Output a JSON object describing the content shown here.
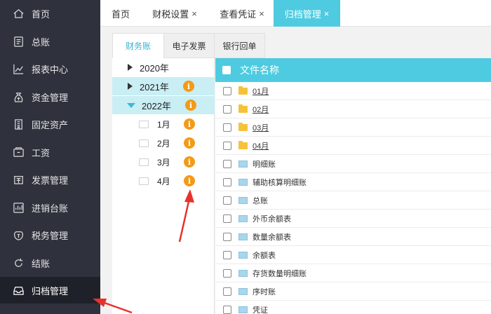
{
  "sidebar": {
    "items": [
      {
        "label": "首页",
        "icon": "home-icon"
      },
      {
        "label": "总账",
        "icon": "ledger-icon"
      },
      {
        "label": "报表中心",
        "icon": "chart-icon"
      },
      {
        "label": "资金管理",
        "icon": "money-bag-icon"
      },
      {
        "label": "固定资产",
        "icon": "building-icon"
      },
      {
        "label": "工资",
        "icon": "wallet-icon"
      },
      {
        "label": "发票管理",
        "icon": "invoice-icon"
      },
      {
        "label": "进销台账",
        "icon": "inventory-icon"
      },
      {
        "label": "税务管理",
        "icon": "tax-icon"
      },
      {
        "label": "结账",
        "icon": "refresh-icon"
      },
      {
        "label": "归档管理",
        "icon": "archive-icon"
      }
    ],
    "active_index": 10
  },
  "top_tabs": [
    {
      "label": "首页",
      "closable": false
    },
    {
      "label": "财税设置",
      "closable": true
    },
    {
      "label": "查看凭证",
      "closable": true
    },
    {
      "label": "归档管理",
      "closable": true,
      "active": true
    }
  ],
  "close_glyph": "×",
  "sub_tabs": [
    {
      "label": "财务账",
      "active": true
    },
    {
      "label": "电子发票"
    },
    {
      "label": "银行回单"
    }
  ],
  "tree": {
    "years": [
      {
        "label": "2020年",
        "badge": false
      },
      {
        "label": "2021年",
        "badge": true
      },
      {
        "label": "2022年",
        "badge": true,
        "expanded": true
      }
    ],
    "months": [
      {
        "label": "1月",
        "badge": true
      },
      {
        "label": "2月",
        "badge": true
      },
      {
        "label": "3月",
        "badge": true
      },
      {
        "label": "4月",
        "badge": true
      }
    ],
    "badge_glyph": "i"
  },
  "file_list": {
    "header": "文件名称",
    "rows": [
      {
        "name": "01月",
        "type": "folder"
      },
      {
        "name": "02月",
        "type": "folder"
      },
      {
        "name": "03月",
        "type": "folder"
      },
      {
        "name": "04月",
        "type": "folder"
      },
      {
        "name": "明细账",
        "type": "file"
      },
      {
        "name": "辅助核算明细账",
        "type": "file"
      },
      {
        "name": "总账",
        "type": "file"
      },
      {
        "name": "外币余额表",
        "type": "file"
      },
      {
        "name": "数量余额表",
        "type": "file"
      },
      {
        "name": "余额表",
        "type": "file"
      },
      {
        "name": "存货数量明细账",
        "type": "file"
      },
      {
        "name": "序时账",
        "type": "file"
      },
      {
        "name": "凭证",
        "type": "file"
      }
    ]
  },
  "colors": {
    "sidebar_bg": "#2f323d",
    "accent": "#4ecbe0",
    "badge": "#f39a17",
    "annotation": "#e8312a"
  }
}
